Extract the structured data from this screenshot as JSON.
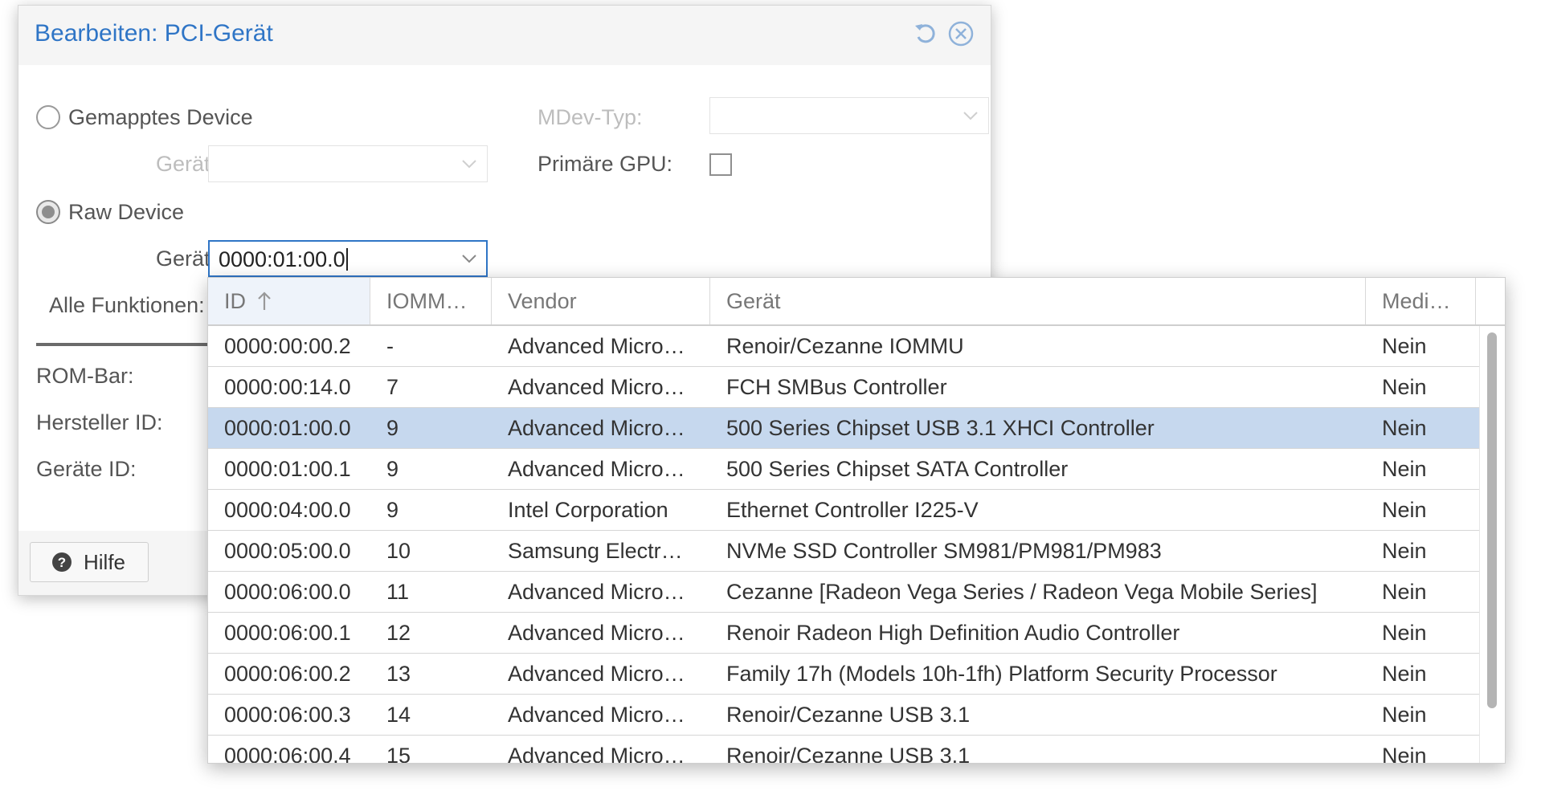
{
  "dialog": {
    "title": "Bearbeiten: PCI-Gerät",
    "tools": {
      "reset_icon": "undo-icon",
      "close_icon": "close-circle-icon"
    },
    "mapped_device": {
      "label": "Gemapptes Device",
      "checked": false
    },
    "mapped_geraet_label": "Gerät:",
    "mdev_label": "MDev-Typ:",
    "primary_gpu_label": "Primäre GPU:",
    "primary_gpu_checked": false,
    "raw_device": {
      "label": "Raw Device",
      "checked": true
    },
    "raw_geraet_label": "Gerät:",
    "raw_geraet_value": "0000:01:00.0",
    "all_functions_label": "Alle Funktionen:",
    "rom_bar_label": "ROM-Bar:",
    "vendor_id_label": "Hersteller ID:",
    "device_id_label": "Geräte ID:",
    "help_label": "Hilfe",
    "colors": {
      "accent": "#2f75c6",
      "selected_row": "#c6d8ee"
    }
  },
  "grid": {
    "columns": [
      "ID",
      "IOMM…",
      "Vendor",
      "Gerät",
      "Medi…"
    ],
    "sorted_column": "ID",
    "sort_direction": "ascending",
    "rows": [
      {
        "id": "0000:00:00.2",
        "iommu": "-",
        "vendor": "Advanced Micro Devices",
        "device": "Renoir/Cezanne IOMMU",
        "mdev": "Nein",
        "selected": false
      },
      {
        "id": "0000:00:14.0",
        "iommu": "7",
        "vendor": "Advanced Micro Devices",
        "device": "FCH SMBus Controller",
        "mdev": "Nein",
        "selected": false
      },
      {
        "id": "0000:01:00.0",
        "iommu": "9",
        "vendor": "Advanced Micro Devices",
        "device": "500 Series Chipset USB 3.1 XHCI Controller",
        "mdev": "Nein",
        "selected": true
      },
      {
        "id": "0000:01:00.1",
        "iommu": "9",
        "vendor": "Advanced Micro Devices",
        "device": "500 Series Chipset SATA Controller",
        "mdev": "Nein",
        "selected": false
      },
      {
        "id": "0000:04:00.0",
        "iommu": "9",
        "vendor": "Intel Corporation",
        "device": "Ethernet Controller I225-V",
        "mdev": "Nein",
        "selected": false
      },
      {
        "id": "0000:05:00.0",
        "iommu": "10",
        "vendor": "Samsung Electronics Co Ltd",
        "device": "NVMe SSD Controller SM981/PM981/PM983",
        "mdev": "Nein",
        "selected": false
      },
      {
        "id": "0000:06:00.0",
        "iommu": "11",
        "vendor": "Advanced Micro Devices",
        "device": "Cezanne [Radeon Vega Series / Radeon Vega Mobile Series]",
        "mdev": "Nein",
        "selected": false
      },
      {
        "id": "0000:06:00.1",
        "iommu": "12",
        "vendor": "Advanced Micro Devices",
        "device": "Renoir Radeon High Definition Audio Controller",
        "mdev": "Nein",
        "selected": false
      },
      {
        "id": "0000:06:00.2",
        "iommu": "13",
        "vendor": "Advanced Micro Devices",
        "device": "Family 17h (Models 10h-1fh) Platform Security Processor",
        "mdev": "Nein",
        "selected": false
      },
      {
        "id": "0000:06:00.3",
        "iommu": "14",
        "vendor": "Advanced Micro Devices",
        "device": "Renoir/Cezanne USB 3.1",
        "mdev": "Nein",
        "selected": false
      },
      {
        "id": "0000:06:00.4",
        "iommu": "15",
        "vendor": "Advanced Micro Devices",
        "device": "Renoir/Cezanne USB 3.1",
        "mdev": "Nein",
        "selected": false
      }
    ]
  }
}
